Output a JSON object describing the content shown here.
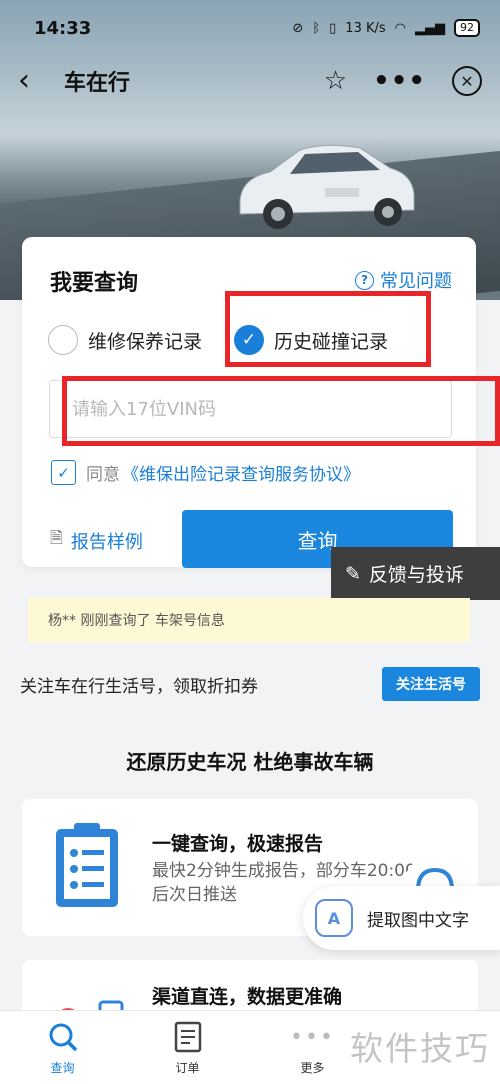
{
  "status_bar": {
    "time": "14:33",
    "network_speed": "13 K/s",
    "battery": "92"
  },
  "navbar": {
    "title": "车在行",
    "back_icon": "back-icon",
    "star_icon": "star-icon",
    "more_icon": "more-icon",
    "close_icon": "close-icon"
  },
  "query_card": {
    "title": "我要查询",
    "faq_label": "常见问题",
    "options": [
      {
        "label": "维修保养记录",
        "selected": false
      },
      {
        "label": "历史碰撞记录",
        "selected": true
      }
    ],
    "vin_placeholder": "请输入17位VIN码",
    "agree_prefix": "同意",
    "agree_link": "《维保出险记录查询服务协议》",
    "agree_checked": true,
    "sample_label": "报告样例",
    "query_button": "查询"
  },
  "feedback_label": "反馈与投诉",
  "notice": "杨** 刚刚查询了 车架号信息",
  "follow": {
    "text": "关注车在行生活号，领取折扣券",
    "button": "关注生活号"
  },
  "section_title": "还原历史车况 杜绝事故车辆",
  "features": [
    {
      "title": "一键查询，极速报告",
      "desc": "最快2分钟生成报告，部分车20:00后次日推送"
    },
    {
      "title": "渠道直连，数据更准确",
      "desc": ""
    }
  ],
  "ocr_label": "提取图中文字",
  "tabs": [
    {
      "label": "查询",
      "active": true
    },
    {
      "label": "订单",
      "active": false
    },
    {
      "label": "更多",
      "active": false
    }
  ],
  "watermark": "软件技巧",
  "colors": {
    "accent": "#1a86dd",
    "highlight": "#e8262a",
    "notice_bg": "#fdf9d4"
  }
}
